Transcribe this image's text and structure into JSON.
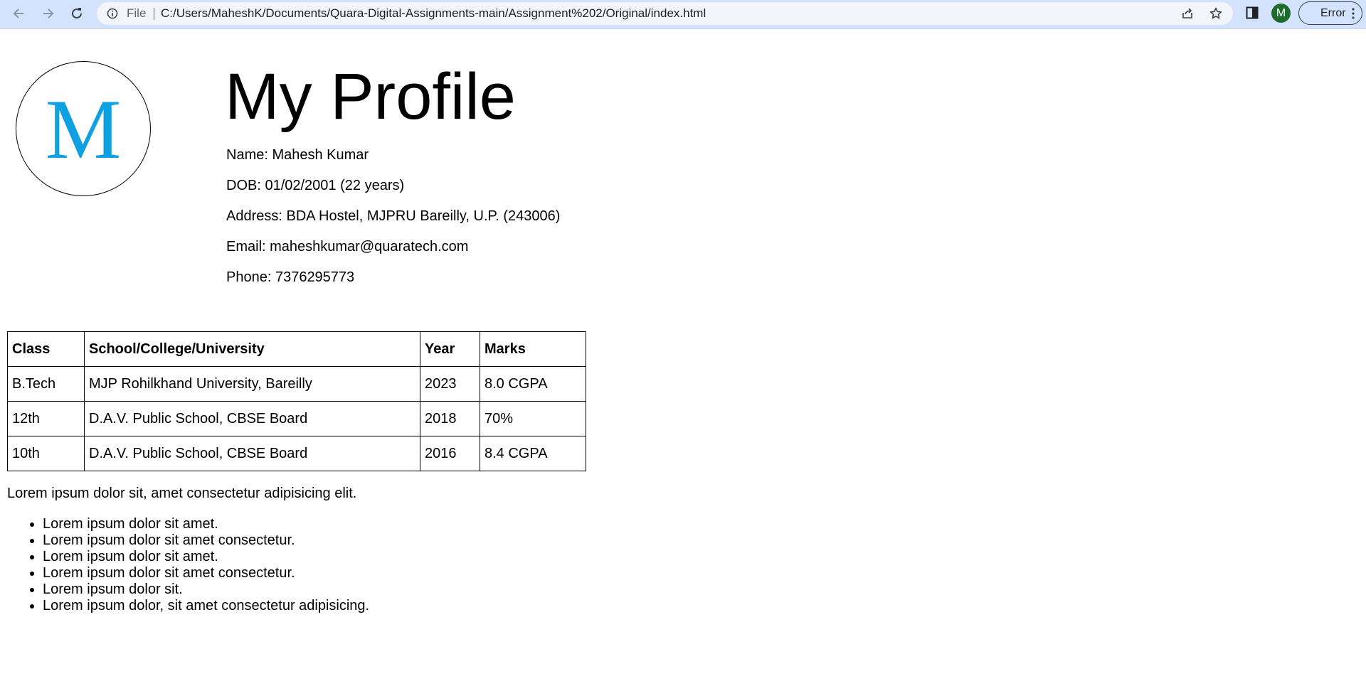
{
  "browser": {
    "file_label": "File",
    "url": "C:/Users/MaheshK/Documents/Quara-Digital-Assignments-main/Assignment%202/Original/index.html",
    "profile_initial": "M",
    "profile_color": "#1e6b2e",
    "error_label": "Error",
    "icons": [
      "back-arrow-icon",
      "forward-arrow-icon",
      "reload-icon",
      "info-icon",
      "share-icon",
      "star-icon",
      "side-panel-icon",
      "kebab-menu-icon"
    ]
  },
  "profile": {
    "avatar_letter": "M",
    "avatar_color": "#0ea0e0",
    "title": "My Profile",
    "name": "Name: Mahesh Kumar",
    "dob": "DOB: 01/02/2001 (22 years)",
    "address": "Address: BDA Hostel, MJPRU Bareilly, U.P. (243006)",
    "email": "Email: maheshkumar@quaratech.com",
    "phone": "Phone: 7376295773"
  },
  "education": {
    "headers": [
      "Class",
      "School/College/University",
      "Year",
      "Marks"
    ],
    "rows": [
      [
        "B.Tech",
        "MJP Rohilkhand University, Bareilly",
        "2023",
        "8.0 CGPA"
      ],
      [
        "12th",
        "D.A.V. Public School, CBSE Board",
        "2018",
        "70%"
      ],
      [
        "10th",
        "D.A.V. Public School, CBSE Board",
        "2016",
        "8.4 CGPA"
      ]
    ]
  },
  "content": {
    "paragraph": "Lorem ipsum dolor sit, amet consectetur adipisicing elit.",
    "list": [
      "Lorem ipsum dolor sit amet.",
      "Lorem ipsum dolor sit amet consectetur.",
      "Lorem ipsum dolor sit amet.",
      "Lorem ipsum dolor sit amet consectetur.",
      "Lorem ipsum dolor sit.",
      "Lorem ipsum dolor, sit amet consectetur adipisicing."
    ]
  }
}
